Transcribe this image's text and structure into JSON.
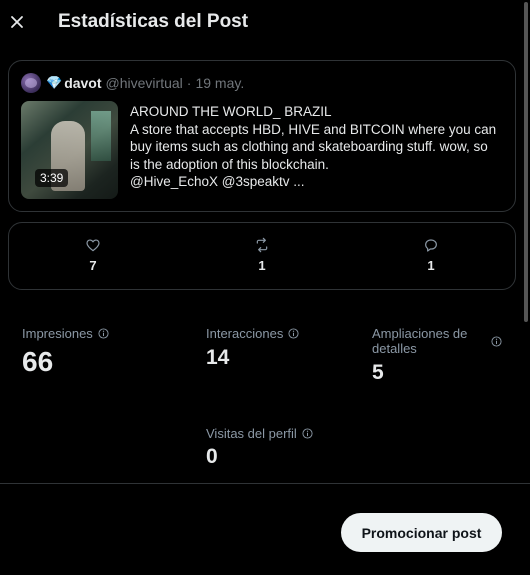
{
  "header": {
    "title": "Estadísticas del Post",
    "close_icon": "close-icon"
  },
  "post": {
    "avatar_icon": "avatar",
    "badge_icon": "diamond-icon",
    "author": "davot",
    "handle": "@hivevirtual",
    "separator": "·",
    "date": "19 may.",
    "video_duration": "3:39",
    "text_lines": [
      "AROUND THE WORLD_ BRAZIL",
      "A store that accepts HBD, HIVE and BITCOIN where you can",
      "buy items such as clothing and skateboarding stuff. wow, so",
      "is the adoption of this blockchain.",
      "@Hive_EchoX @3speaktv ..."
    ]
  },
  "engagement": [
    {
      "icon": "heart-icon",
      "count": "7"
    },
    {
      "icon": "repost-icon",
      "count": "1"
    },
    {
      "icon": "reply-icon",
      "count": "1"
    }
  ],
  "stats": {
    "impressions": {
      "label": "Impresiones",
      "value": "66"
    },
    "interactions": {
      "label": "Interacciones",
      "value": "14"
    },
    "detail_expands": {
      "label_line1": "Ampliaciones de",
      "label_line2": "detalles",
      "value": "5"
    },
    "profile_visits": {
      "label": "Visitas del perfil",
      "value": "0"
    }
  },
  "footer": {
    "promote_label": "Promocionar post"
  },
  "colors": {
    "background": "#000000",
    "text": "#e7e9ea",
    "muted": "#71767b",
    "border": "#2f3336",
    "button_bg": "#eff3f4"
  }
}
